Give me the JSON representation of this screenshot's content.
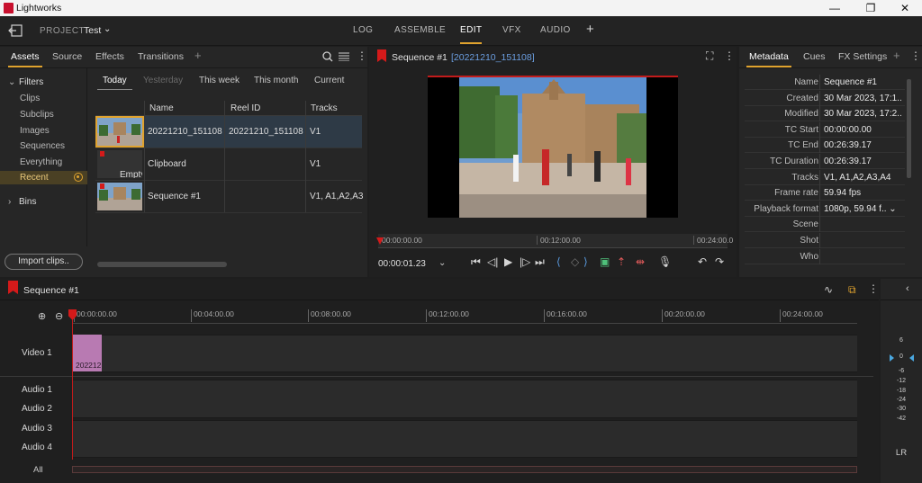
{
  "window": {
    "title": "Lightworks",
    "minimize": "—",
    "maximize": "❐",
    "close": "✕"
  },
  "topnav": {
    "project_label": "PROJECT",
    "project_name": "Test",
    "tabs": [
      "LOG",
      "ASSEMBLE",
      "EDIT",
      "VFX",
      "AUDIO"
    ],
    "active_tab": "EDIT",
    "add": "+"
  },
  "assets": {
    "tabs": [
      "Assets",
      "Source",
      "Effects",
      "Transitions"
    ],
    "add": "+",
    "filters_head": "Filters",
    "filters": [
      "Clips",
      "Subclips",
      "Images",
      "Sequences",
      "Everything",
      "Recent"
    ],
    "bins_head": "Bins",
    "date_tabs": [
      "Today",
      "Yesterday",
      "This week",
      "This month",
      "Current"
    ],
    "columns": [
      "Name",
      "Reel ID",
      "Tracks"
    ],
    "rows": [
      {
        "name": "20221210_151108",
        "reel": "20221210_151108",
        "tracks": "V1"
      },
      {
        "name": "Clipboard",
        "reel": "",
        "tracks": "V1",
        "thumb": "Empty"
      },
      {
        "name": "Sequence #1",
        "reel": "",
        "tracks": "V1, A1,A2,A3"
      }
    ],
    "import_button": "Import clips.."
  },
  "viewer": {
    "title": "Sequence #1",
    "code": "[20221210_151108]",
    "ruler_ticks": [
      "00:00:00.00",
      "00:12:00.00",
      "00:24:00.0"
    ],
    "timecode": "00:00:01.23"
  },
  "metadata": {
    "tabs": [
      "Metadata",
      "Cues",
      "FX Settings"
    ],
    "add": "+",
    "rows": [
      {
        "k": "Name",
        "v": "Sequence #1"
      },
      {
        "k": "Created",
        "v": "30 Mar 2023, 17:1.."
      },
      {
        "k": "Modified",
        "v": "30 Mar 2023, 17:2.."
      },
      {
        "k": "TC Start",
        "v": "00:00:00.00"
      },
      {
        "k": "TC End",
        "v": "00:26:39.17"
      },
      {
        "k": "TC Duration",
        "v": "00:26:39.17"
      },
      {
        "k": "Tracks",
        "v": "V1, A1,A2,A3,A4"
      },
      {
        "k": "Frame rate",
        "v": "59.94 fps"
      },
      {
        "k": "Playback format",
        "v": "1080p, 59.94 f.. ⌄"
      },
      {
        "k": "Scene",
        "v": ""
      },
      {
        "k": "Shot",
        "v": ""
      },
      {
        "k": "Who",
        "v": ""
      }
    ]
  },
  "timeline": {
    "title": "Sequence #1",
    "ruler": [
      "00:00:00.00",
      "00:04:00.00",
      "00:08:00.00",
      "00:12:00.00",
      "00:16:00.00",
      "00:20:00.00",
      "00:24:00.00"
    ],
    "tracks": [
      "Video 1",
      "Audio 1",
      "Audio 2",
      "Audio 3",
      "Audio 4"
    ],
    "clip_label": "202212",
    "all_label": "All"
  },
  "meters": {
    "scale": [
      "6",
      "0",
      "-6",
      "-12",
      "-18",
      "-24",
      "-30",
      "-42"
    ],
    "channels": "LR"
  },
  "colors": {
    "accent": "#e0a32e",
    "red": "#d41a1a",
    "link_blue": "#6b9ee0",
    "clip_pink": "#b87ab2"
  }
}
